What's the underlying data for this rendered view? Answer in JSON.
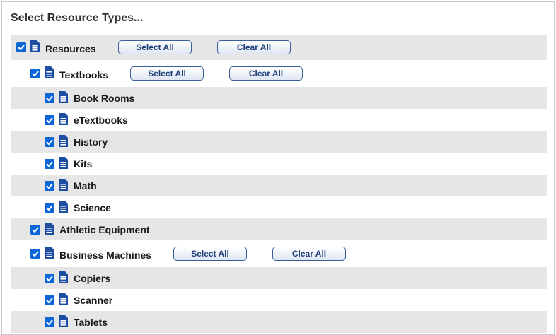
{
  "panel": {
    "title": "Select Resource Types..."
  },
  "buttons": {
    "select_all": "Select All",
    "clear_all": "Clear All"
  },
  "tree": [
    {
      "label": "Resources",
      "checked": true,
      "level": 0,
      "has_buttons": true
    },
    {
      "label": "Textbooks",
      "checked": true,
      "level": 1,
      "has_buttons": true
    },
    {
      "label": "Book Rooms",
      "checked": true,
      "level": 2
    },
    {
      "label": "eTextbooks",
      "checked": true,
      "level": 2
    },
    {
      "label": "History",
      "checked": true,
      "level": 2
    },
    {
      "label": "Kits",
      "checked": true,
      "level": 2
    },
    {
      "label": "Math",
      "checked": true,
      "level": 2
    },
    {
      "label": "Science",
      "checked": true,
      "level": 2
    },
    {
      "label": "Athletic Equipment",
      "checked": true,
      "level": 1
    },
    {
      "label": "Business Machines",
      "checked": true,
      "level": 1,
      "has_buttons": true
    },
    {
      "label": "Copiers",
      "checked": true,
      "level": 2
    },
    {
      "label": "Scanner",
      "checked": true,
      "level": 2
    },
    {
      "label": "Tablets",
      "checked": true,
      "level": 2
    }
  ],
  "colors": {
    "checkbox": "#0b66d8",
    "doc_icon": "#1e4ea3",
    "row_shade": "#e6e6e6",
    "button_text": "#1f3f78"
  }
}
